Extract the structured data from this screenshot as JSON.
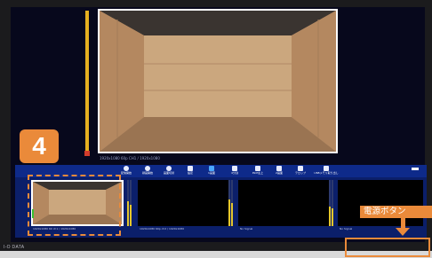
{
  "main_view": {
    "caption": "1920x1080 60p CH1 / 1920x1080"
  },
  "step_badge": "4",
  "toolbar": {
    "items": [
      {
        "label": "配信開始",
        "icon": "broadcast-icon"
      },
      {
        "label": "録画開始",
        "icon": "record-icon"
      },
      {
        "label": "画面切替",
        "icon": "switch-icon"
      },
      {
        "label": "設定",
        "icon": "wrench-icon"
      },
      {
        "label": "1画面",
        "icon": "single-screen-icon"
      },
      {
        "label": "4分割",
        "icon": "quad-split-icon"
      },
      {
        "label": "PinP左上",
        "icon": "pip-icon"
      },
      {
        "label": "2画面",
        "icon": "dual-screen-icon"
      },
      {
        "label": "テロップ",
        "icon": "caption-icon"
      },
      {
        "label": "USBメモリ取り出し",
        "icon": "usb-eject-icon"
      }
    ]
  },
  "cameras": [
    {
      "name": "CH1",
      "caption": "1920x1080 60 ch1 / 1920x1080"
    },
    {
      "name": "CH2",
      "caption": "1920x1080 60p ch2 / 1920x1080"
    },
    {
      "name": "CH3",
      "caption": "No Signal"
    },
    {
      "name": "CH4",
      "caption": "No Signal"
    }
  ],
  "annotation": {
    "power_label": "電源ボタン"
  },
  "brand": "I-O DATA",
  "colors": {
    "accent": "#ea8a3a",
    "toolbar": "#0e2a8a",
    "screen": "#07081c",
    "meter": "#e6c72c"
  }
}
